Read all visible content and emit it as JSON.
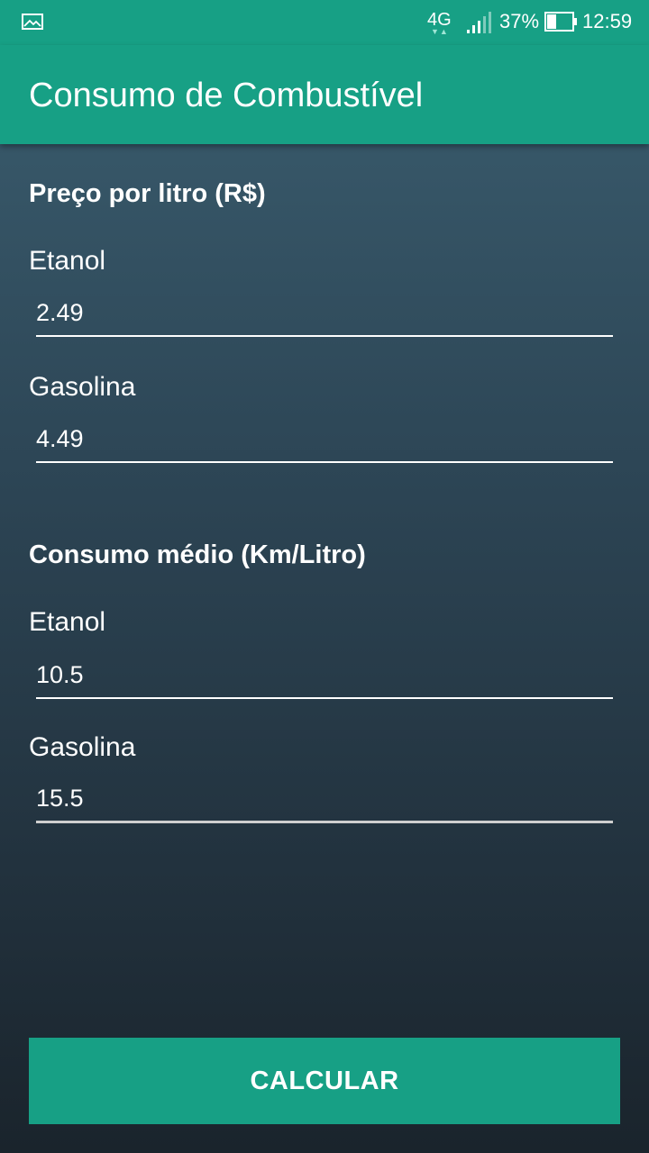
{
  "status_bar": {
    "network": "4G",
    "network_arrows": "▼▲",
    "battery_percent": "37%",
    "battery_level": 0.37,
    "time": "12:59",
    "icons": [
      "image-icon",
      "signal-icon",
      "battery-icon"
    ]
  },
  "app_bar": {
    "title": "Consumo de Combustível"
  },
  "price_section": {
    "header": "Preço por litro (R$)",
    "ethanol_label": "Etanol",
    "ethanol_value": "2.49",
    "gasoline_label": "Gasolina",
    "gasoline_value": "4.49"
  },
  "consumption_section": {
    "header": "Consumo médio (Km/Litro)",
    "ethanol_label": "Etanol",
    "ethanol_value": "10.5",
    "gasoline_label": "Gasolina",
    "gasoline_value": "15.5"
  },
  "actions": {
    "calculate_label": "CALCULAR"
  },
  "colors": {
    "accent": "#17a085",
    "background_top": "#3b5e70",
    "background_bottom": "#1a242c",
    "text": "#ffffff"
  }
}
